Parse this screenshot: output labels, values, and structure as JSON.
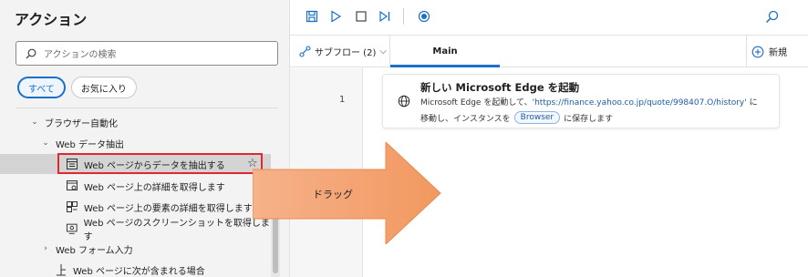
{
  "left_panel": {
    "title": "アクション",
    "search_placeholder": "アクションの検索",
    "filters": [
      {
        "label": "すべて",
        "active": true
      },
      {
        "label": "お気に入り",
        "active": false
      }
    ],
    "tree": {
      "browser_automation": "ブラウザー自動化",
      "web_data_extraction": "Web データ抽出",
      "items": [
        {
          "label": "Web ページからデータを抽出する",
          "icon": "table-extract-icon",
          "selected": true
        },
        {
          "label": "Web ページ上の詳細を取得します",
          "icon": "page-details-icon"
        },
        {
          "label": "Web ページ上の要素の詳細を取得します",
          "icon": "element-details-icon"
        },
        {
          "label": "Web ページのスクリーンショットを取得します",
          "icon": "screenshot-icon"
        }
      ],
      "web_form_input": "Web フォーム入力",
      "web_contains": "Web ページに次が含まれる場合"
    }
  },
  "toolbar": {
    "icons": [
      "save-icon",
      "run-icon",
      "stop-icon",
      "step-icon",
      "record-icon",
      "search-icon"
    ]
  },
  "tabs": {
    "subflow_label": "サブフロー (2)",
    "main_tab": "Main",
    "new_label": "新規"
  },
  "steps": [
    {
      "number": "1",
      "title": "新しい Microsoft Edge を起動",
      "desc_prefix": "Microsoft Edge を起動して、",
      "url": "'https://finance.yahoo.co.jp/quote/998407.O/history'",
      "desc_suffix": " に",
      "desc_line2_prefix": "移動し、インスタンスを",
      "variable": "Browser",
      "desc_line2_suffix": "に保存します"
    }
  ],
  "overlay": {
    "drag_label": "ドラッグ",
    "arrow_color": "#f5a06a"
  },
  "colors": {
    "accent": "#1c6fc7",
    "highlight_border": "#e0282e"
  }
}
